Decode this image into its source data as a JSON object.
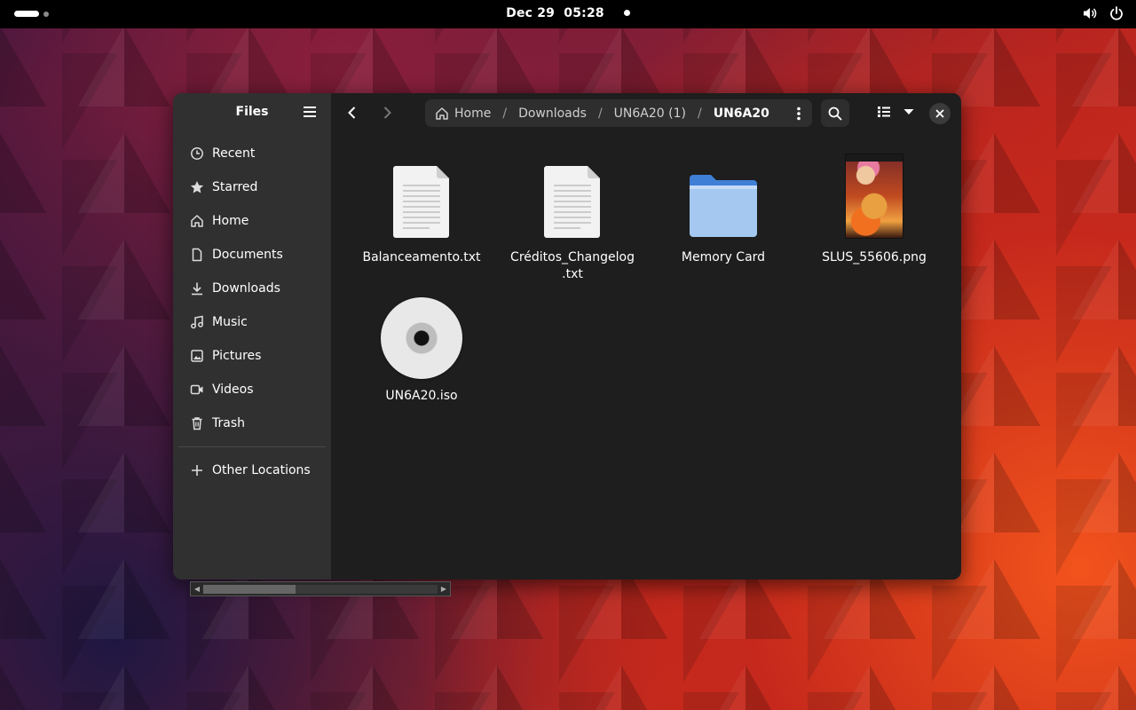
{
  "topbar": {
    "clock": "Dec 29  05:28"
  },
  "window": {
    "sidebar": {
      "title": "Files",
      "items": [
        {
          "label": "Recent",
          "icon": "clock-icon"
        },
        {
          "label": "Starred",
          "icon": "star-icon"
        },
        {
          "label": "Home",
          "icon": "home-icon"
        },
        {
          "label": "Documents",
          "icon": "document-icon"
        },
        {
          "label": "Downloads",
          "icon": "download-icon"
        },
        {
          "label": "Music",
          "icon": "music-icon"
        },
        {
          "label": "Pictures",
          "icon": "picture-icon"
        },
        {
          "label": "Videos",
          "icon": "video-icon"
        },
        {
          "label": "Trash",
          "icon": "trash-icon"
        }
      ],
      "other_locations": "Other Locations"
    },
    "pathbar": {
      "crumbs": [
        "Home",
        "Downloads",
        "UN6A20 (1)",
        "UN6A20"
      ],
      "separator": "/"
    },
    "files": [
      {
        "name": "Balanceamento.txt",
        "type": "text"
      },
      {
        "name_line1": "Créditos_Changelog",
        "name_line2": ".txt",
        "type": "text"
      },
      {
        "name": "Memory Card",
        "type": "folder"
      },
      {
        "name": "SLUS_55606.png",
        "type": "image"
      },
      {
        "name": "UN6A20.iso",
        "type": "disc"
      }
    ],
    "colors": {
      "folder": "#5b9ae8",
      "sidebar_bg": "#303030",
      "content_bg": "#1e1e1e"
    }
  }
}
